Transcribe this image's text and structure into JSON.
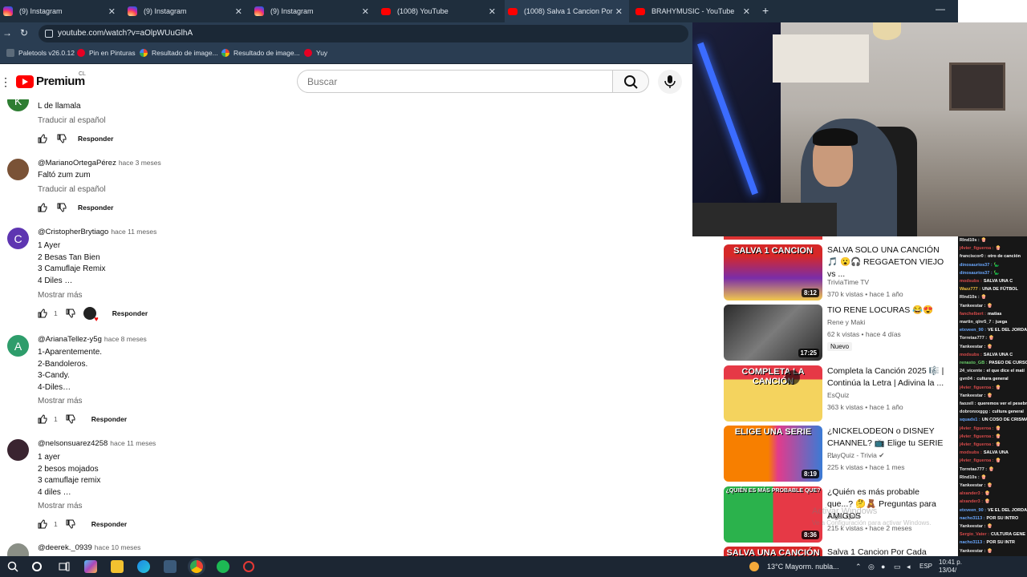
{
  "tabs": [
    {
      "title": "(9) Instagram",
      "favicon": "instagram-icon",
      "active": false
    },
    {
      "title": "(9) Instagram",
      "favicon": "instagram-icon",
      "active": false
    },
    {
      "title": "(9) Instagram",
      "favicon": "instagram-icon",
      "active": false
    },
    {
      "title": "(1008) YouTube",
      "favicon": "youtube-icon",
      "active": false
    },
    {
      "title": "(1008) Salva 1 Cancion Por Cad",
      "favicon": "youtube-icon",
      "active": true
    },
    {
      "title": "BRAHYMUSIC - YouTube",
      "favicon": "youtube-icon",
      "active": false
    }
  ],
  "address": {
    "url": "youtube.com/watch?v=aOlpWUuGlhA"
  },
  "bookmarks": [
    {
      "label": "Paletools v26.0.12",
      "icon": "paletools-icon"
    },
    {
      "label": "Pin en Pinturas",
      "icon": "pinterest-icon"
    },
    {
      "label": "Resultado de image...",
      "icon": "google-icon"
    },
    {
      "label": "Resultado de image...",
      "icon": "google-icon"
    },
    {
      "label": "Yuy",
      "icon": "pinterest-icon"
    }
  ],
  "header": {
    "brand": "Premium",
    "country": "CL",
    "search_placeholder": "Buscar"
  },
  "comments": [
    {
      "author": "",
      "time": "",
      "avatar_letter": "K",
      "avatar_color": "#2e7d32",
      "lines": [
        "L de llamala"
      ],
      "translate": "Traducir al español",
      "more": "",
      "likes": "",
      "reply": "Responder"
    },
    {
      "author": "@MarianoOrtegaPérez",
      "time": "hace 3 meses",
      "avatar_letter": "",
      "avatar_color": "#7a5236",
      "lines": [
        "Faltó zum zum"
      ],
      "translate": "Traducir al español",
      "more": "",
      "likes": "",
      "reply": "Responder"
    },
    {
      "author": "@CristopherBrytiago",
      "time": "hace 11 meses",
      "avatar_letter": "C",
      "avatar_color": "#5e35b1",
      "lines": [
        "1 Ayer",
        "2 Besas Tan Bien",
        "3 Camuflaje Remix",
        "4 Diles …"
      ],
      "translate": "",
      "more": "Mostrar más",
      "likes": "1",
      "reply": "Responder"
    },
    {
      "author": "@ArianaTellez-y5g",
      "time": "hace 8 meses",
      "avatar_letter": "A",
      "avatar_color": "#2e9d6b",
      "lines": [
        "1-Aparentemente.",
        "2-Bandoleros.",
        "3-Candy.",
        "4-Diles…"
      ],
      "translate": "",
      "more": "Mostrar más",
      "likes": "1",
      "reply": "Responder"
    },
    {
      "author": "@nelsonsuarez4258",
      "time": "hace 11 meses",
      "avatar_letter": "",
      "avatar_color": "#3a2430",
      "lines": [
        "1 ayer",
        "2 besos mojados",
        "3 camuflaje remix",
        "4 diles …"
      ],
      "translate": "",
      "more": "Mostrar más",
      "likes": "1",
      "reply": "Responder"
    },
    {
      "author": "@deerek._0939",
      "time": "hace 10 meses",
      "avatar_letter": "",
      "avatar_color": "#8a8f86",
      "lines": [],
      "translate": "",
      "more": "",
      "likes": "",
      "reply": ""
    }
  ],
  "recommendations": [
    {
      "title": "SALVA SOLO UNA CANCIÓN 🎵 😮🎧 REGGAETON VIEJO vs ...",
      "channel": "TriviaTime TV",
      "stats": "370 k vistas • hace 1 año",
      "duration": "8:12",
      "thumb_text": "SALVA 1 CANCION",
      "badge": ""
    },
    {
      "title": "TIO RENE LOCURAS 😂😍",
      "channel": "Rene y Maki",
      "stats": "62 k vistas • hace 4 días",
      "duration": "17:25",
      "thumb_text": "",
      "badge": "Nuevo"
    },
    {
      "title": "Completa la Canción 2025 🎼 | Continúa la Letra | Adivina la ...",
      "channel": "EsQuiz",
      "stats": "363 k vistas • hace 1 año",
      "duration": "",
      "thumb_text": "COMPLETA LA CANCIÓN",
      "badge": ""
    },
    {
      "title": "¿NICKELODEON o DISNEY CHANNEL? 📺 Elige tu SERIE ...",
      "channel": "PlayQuiz - Trivia",
      "stats": "225 k vistas • hace 1 mes",
      "duration": "8:19",
      "thumb_text": "ELIGE UNA SERIE",
      "badge": ""
    },
    {
      "title": "¿Quién es más probable que...? 🤔🧸 Preguntas para AMIGOS",
      "channel": "Jugar Quiz",
      "stats": "215 k vistas • hace 2 meses",
      "duration": "8:36",
      "thumb_text": "¿QUIÉN ES MÁS PROBABLE QUE?",
      "badge": ""
    },
    {
      "title": "Salva 1 Cancion Por Cada",
      "channel": "",
      "stats": "",
      "duration": "",
      "thumb_text": "SALVA UNA CANCIÓN",
      "badge": ""
    }
  ],
  "chat": [
    {
      "user": "Rlnd10s :",
      "msg": "🍿",
      "color": "#e8e8e8"
    },
    {
      "user": "j4vier_figueroa :",
      "msg": "🍿",
      "color": "#d84a4a"
    },
    {
      "user": "franciscor0 :",
      "msg": "otro de canción",
      "color": "#e8e8e8"
    },
    {
      "user": "dinosaurios37 :",
      "msg": "🦕",
      "color": "#6aa8ff"
    },
    {
      "user": "dinosaurios37 :",
      "msg": "🦕",
      "color": "#6aa8ff"
    },
    {
      "user": "modsubs :",
      "msg": "SALVA UNA C",
      "color": "#d84a4a"
    },
    {
      "user": "Wazz777 :",
      "msg": "UNA DE FÚTBOL",
      "color": "#f0c040"
    },
    {
      "user": "Rlnd10s :",
      "msg": "🍿",
      "color": "#e8e8e8"
    },
    {
      "user": "Yankeestar :",
      "msg": "🍿",
      "color": "#e8e8e8"
    },
    {
      "user": "fanchelbert :",
      "msg": "matias",
      "color": "#d84a4a"
    },
    {
      "user": "martin_qlnr5_7 :",
      "msg": "juega",
      "color": "#e8e8e8"
    },
    {
      "user": "etxveen_90 :",
      "msg": "VE EL DEL JORDA",
      "color": "#6aa8ff"
    },
    {
      "user": "Torretas777 :",
      "msg": "🍿",
      "color": "#e8e8e8"
    },
    {
      "user": "Yankeestar :",
      "msg": "🍿",
      "color": "#e8e8e8"
    },
    {
      "user": "modsubs :",
      "msg": "SALVA UNA C",
      "color": "#d84a4a"
    },
    {
      "user": "renasto_GB :",
      "msg": "PASEO DE CURSO",
      "color": "#6ad06a"
    },
    {
      "user": "24_vicente :",
      "msg": "el que dice el matí",
      "color": "#e8e8e8"
    },
    {
      "user": "gvn04 :",
      "msg": "cultura general",
      "color": "#e8e8e8"
    },
    {
      "user": "j4vier_figueroa :",
      "msg": "🍿",
      "color": "#d84a4a"
    },
    {
      "user": "Yankeestar :",
      "msg": "🍿",
      "color": "#e8e8e8"
    },
    {
      "user": "faozell :",
      "msg": "queremos ver el pesebr",
      "color": "#e8e8e8"
    },
    {
      "user": "dobronxxggg :",
      "msg": "cultura general",
      "color": "#e8e8e8"
    },
    {
      "user": "squads1 :",
      "msg": "UN COSO DE CRISMA",
      "color": "#6aa8ff"
    },
    {
      "user": "j4vier_figueroa :",
      "msg": "🍿",
      "color": "#d84a4a"
    },
    {
      "user": "j4vier_figueroa :",
      "msg": "🍿",
      "color": "#d84a4a"
    },
    {
      "user": "j4vier_figueroa :",
      "msg": "🍿",
      "color": "#d84a4a"
    },
    {
      "user": "modsubs :",
      "msg": "SALVA UNA",
      "color": "#d84a4a"
    },
    {
      "user": "j4vier_figueroa :",
      "msg": "🍿",
      "color": "#d84a4a"
    },
    {
      "user": "Torretas777 :",
      "msg": "🍿",
      "color": "#e8e8e8"
    },
    {
      "user": "Rlnd10s :",
      "msg": "🍿",
      "color": "#e8e8e8"
    },
    {
      "user": "Yankeestar :",
      "msg": "🍿",
      "color": "#e8e8e8"
    },
    {
      "user": "alxander3 :",
      "msg": "🍿",
      "color": "#d84a4a"
    },
    {
      "user": "alxander3 :",
      "msg": "🍿",
      "color": "#d84a4a"
    },
    {
      "user": "etxveen_90 :",
      "msg": "VE EL DEL JORDA",
      "color": "#6aa8ff"
    },
    {
      "user": "nacho3113 :",
      "msg": "POR SU INTRO",
      "color": "#6aa8ff"
    },
    {
      "user": "Yankeestar :",
      "msg": "🍿",
      "color": "#e8e8e8"
    },
    {
      "user": "Sergio_Vater :",
      "msg": "CULTURA GENE",
      "color": "#d84a4a"
    },
    {
      "user": "nacho3113 :",
      "msg": "POR SU INTR",
      "color": "#6aa8ff"
    },
    {
      "user": "Yankeestar :",
      "msg": "🍿",
      "color": "#e8e8e8"
    },
    {
      "user": "alex_9_4 :",
      "msg": "🍿",
      "color": "#6ad06a"
    }
  ],
  "watermark": {
    "title": "Activar Windows",
    "subtitle": "Ve a Configuración para activar Windows."
  },
  "taskbar": {
    "weather": "13°C  Mayorm. nubla...",
    "lang": "ESP",
    "time": "10:41 p.",
    "date": "13/04/"
  }
}
